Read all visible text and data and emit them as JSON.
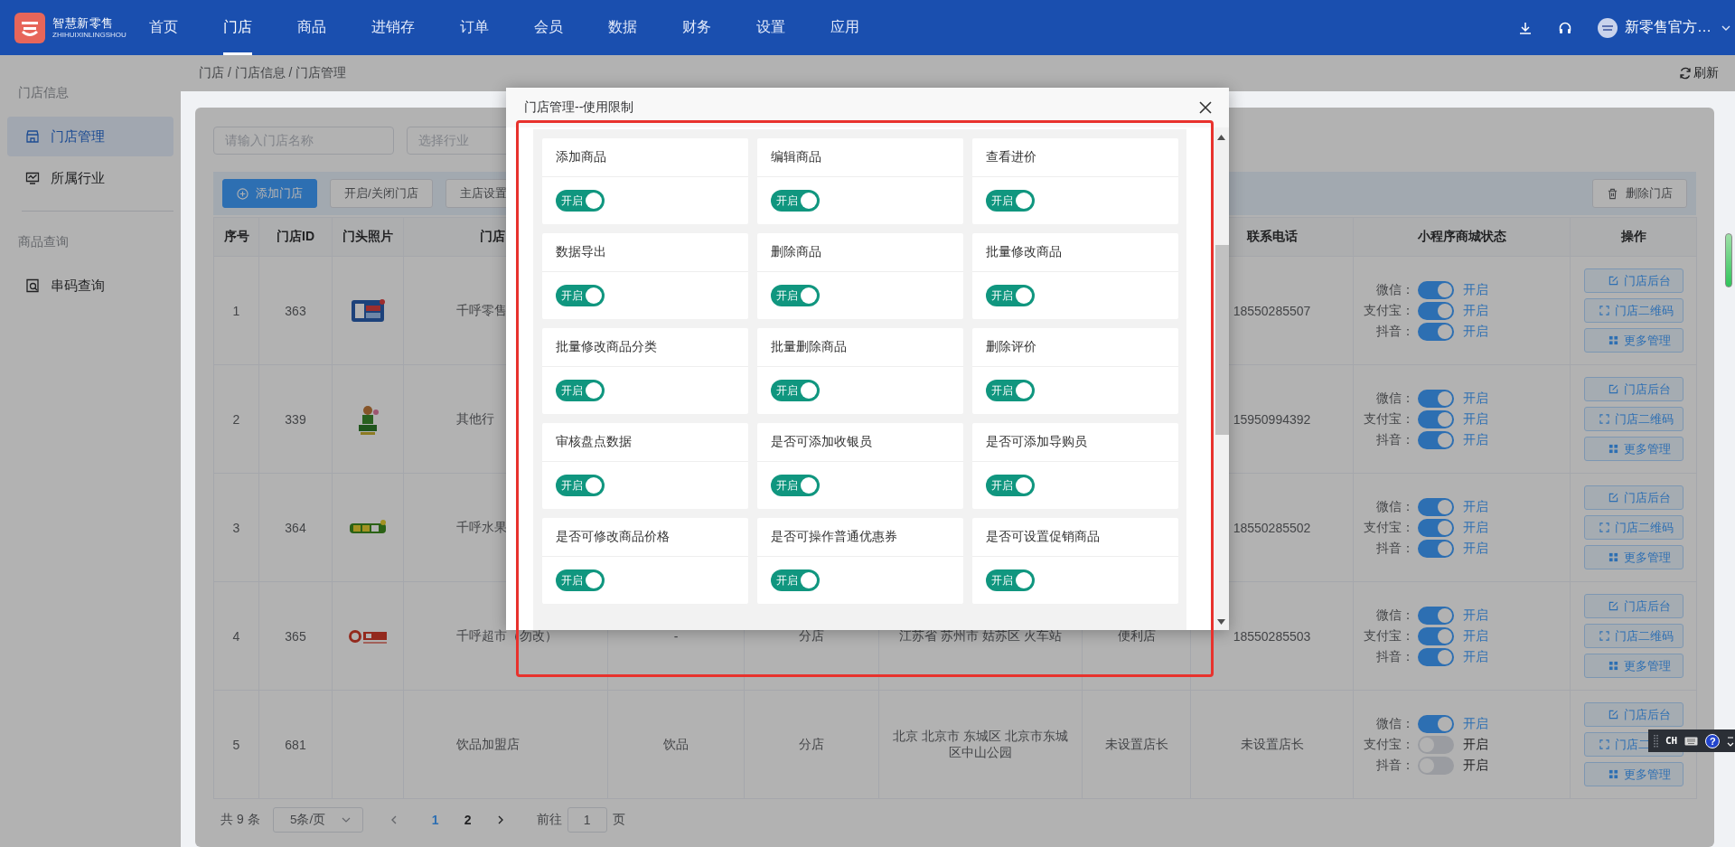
{
  "topbar": {
    "brand": "智慧新零售",
    "brand_sub": "ZHIHUIXINLINGSHOU",
    "nav": [
      {
        "label": "首页",
        "selected": false
      },
      {
        "label": "门店",
        "selected": true
      },
      {
        "label": "商品",
        "selected": false
      },
      {
        "label": "进销存",
        "selected": false
      },
      {
        "label": "订单",
        "selected": false
      },
      {
        "label": "会员",
        "selected": false
      },
      {
        "label": "数据",
        "selected": false
      },
      {
        "label": "财务",
        "selected": false
      },
      {
        "label": "设置",
        "selected": false
      },
      {
        "label": "应用",
        "selected": false
      }
    ],
    "user": "新零售官方…"
  },
  "sidebar": [
    {
      "title": "门店信息",
      "items": [
        {
          "label": "门店管理",
          "selected": true
        },
        {
          "label": "所属行业",
          "selected": false
        }
      ]
    },
    {
      "title": "商品查询",
      "items": [
        {
          "label": "串码查询",
          "selected": false
        }
      ]
    }
  ],
  "breadcrumb": "门店 / 门店信息 / 门店管理",
  "refresh": "刷新",
  "filters": [
    {
      "placeholder": "请输入门店名称"
    },
    {
      "placeholder": "选择行业"
    }
  ],
  "toolbar": {
    "left": [
      {
        "label": "添加门店",
        "kind": "primary"
      },
      {
        "label": "开启/关闭门店",
        "kind": "plain"
      },
      {
        "label": "主店设置",
        "kind": "plain"
      }
    ],
    "right": [
      {
        "label": "删除门店",
        "kind": "delete"
      }
    ]
  },
  "table": {
    "columns_left": [
      "序号",
      "门店ID",
      "门头照片",
      "门店"
    ],
    "columns_right": [
      "联系电话",
      "小程序商城状态",
      "操作"
    ],
    "rows": [
      {
        "index": "1",
        "store_id": "363",
        "photo": {
          "kind": "picture"
        },
        "name": "千呼零售",
        "phone": "18550285507",
        "status": [
          {
            "label": "微信：",
            "on": true,
            "text": "开启"
          },
          {
            "label": "支付宝：",
            "on": true,
            "text": "开启"
          },
          {
            "label": "抖音：",
            "on": true,
            "text": "开启"
          }
        ],
        "actions": [
          {
            "label": "门店后台"
          },
          {
            "label": "门店二维码"
          },
          {
            "label": "更多管理"
          }
        ]
      },
      {
        "index": "2",
        "store_id": "339",
        "photo": {
          "kind": "picture"
        },
        "name": "其他行",
        "phone": "15950994392",
        "status": [
          {
            "label": "微信：",
            "on": true,
            "text": "开启"
          },
          {
            "label": "支付宝：",
            "on": true,
            "text": "开启"
          },
          {
            "label": "抖音：",
            "on": true,
            "text": "开启"
          }
        ],
        "actions": [
          {
            "label": "门店后台"
          },
          {
            "label": "门店二维码"
          },
          {
            "label": "更多管理"
          }
        ]
      },
      {
        "index": "3",
        "store_id": "364",
        "photo": {
          "kind": "picture"
        },
        "name": "千呼水果",
        "phone": "18550285502",
        "status": [
          {
            "label": "微信：",
            "on": true,
            "text": "开启"
          },
          {
            "label": "支付宝：",
            "on": true,
            "text": "开启"
          },
          {
            "label": "抖音：",
            "on": true,
            "text": "开启"
          }
        ],
        "actions": [
          {
            "label": "门店后台"
          },
          {
            "label": "门店二维码"
          },
          {
            "label": "更多管理"
          }
        ]
      },
      {
        "index": "4",
        "store_id": "365",
        "photo": {
          "kind": "picture"
        },
        "name": "千呼超市（勿改）",
        "details": [
          "-",
          "分店",
          "江苏省 苏州市 姑苏区 火车站",
          "便利店"
        ],
        "phone": "18550285503",
        "status": [
          {
            "label": "微信：",
            "on": true,
            "text": "开启"
          },
          {
            "label": "支付宝：",
            "on": true,
            "text": "开启"
          },
          {
            "label": "抖音：",
            "on": true,
            "text": "开启"
          }
        ],
        "actions": [
          {
            "label": "门店后台"
          },
          {
            "label": "门店二维码"
          },
          {
            "label": "更多管理"
          }
        ]
      },
      {
        "index": "5",
        "store_id": "681",
        "name": "饮品加盟店",
        "details": [
          "饮品",
          "分店",
          "北京 北京市 东城区 北京市东城区中山公园",
          "未设置店长"
        ],
        "phone": "未设置店长",
        "status": [
          {
            "label": "微信：",
            "on": true,
            "text": "开启"
          },
          {
            "label": "支付宝：",
            "on": false,
            "text": "开启"
          },
          {
            "label": "抖音：",
            "on": false,
            "text": "开启"
          }
        ],
        "actions": [
          {
            "label": "门店后台"
          },
          {
            "label": "门店二"
          },
          {
            "label": "更多管理"
          }
        ]
      }
    ]
  },
  "pagination": {
    "total": "共 9 条",
    "page_size": "5条/页",
    "pages": [
      {
        "label": "1",
        "selected": true
      },
      {
        "label": "2",
        "selected": false
      }
    ],
    "goto_label": "前往",
    "goto_value": "1",
    "page_unit": "页"
  },
  "modal": {
    "title": "门店管理--使用限制",
    "permissions": [
      {
        "label": "添加商品",
        "on": true,
        "toggle_text": "开启"
      },
      {
        "label": "编辑商品",
        "on": true,
        "toggle_text": "开启"
      },
      {
        "label": "查看进价",
        "on": true,
        "toggle_text": "开启"
      },
      {
        "label": "数据导出",
        "on": true,
        "toggle_text": "开启"
      },
      {
        "label": "删除商品",
        "on": true,
        "toggle_text": "开启"
      },
      {
        "label": "批量修改商品",
        "on": true,
        "toggle_text": "开启"
      },
      {
        "label": "批量修改商品分类",
        "on": true,
        "toggle_text": "开启"
      },
      {
        "label": "批量删除商品",
        "on": true,
        "toggle_text": "开启"
      },
      {
        "label": "删除评价",
        "on": true,
        "toggle_text": "开启"
      },
      {
        "label": "审核盘点数据",
        "on": true,
        "toggle_text": "开启"
      },
      {
        "label": "是否可添加收银员",
        "on": true,
        "toggle_text": "开启"
      },
      {
        "label": "是否可添加导购员",
        "on": true,
        "toggle_text": "开启"
      },
      {
        "label": "是否可修改商品价格",
        "on": true,
        "toggle_text": "开启"
      },
      {
        "label": "是否可操作普通优惠券",
        "on": true,
        "toggle_text": "开启"
      },
      {
        "label": "是否可设置促销商品",
        "on": true,
        "toggle_text": "开启"
      }
    ]
  },
  "ime_bar": {
    "label": "CH",
    "help": "?"
  }
}
